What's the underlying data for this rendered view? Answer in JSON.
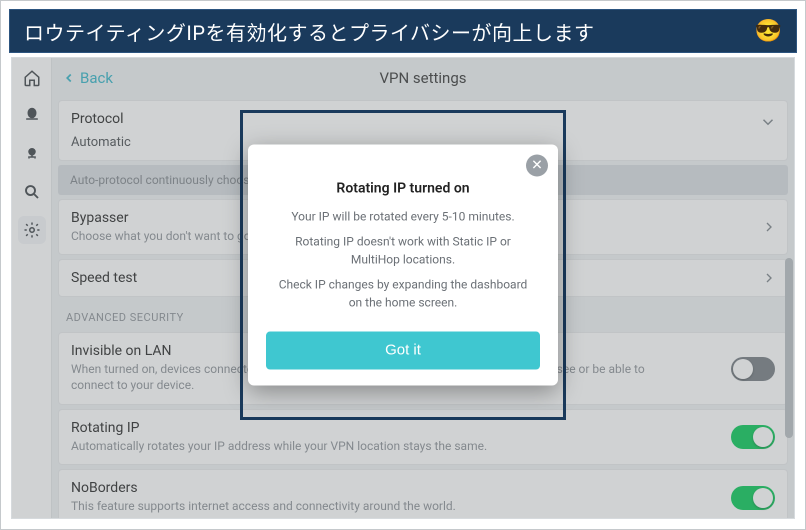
{
  "banner": {
    "text": "ロウテイティングIPを有効化するとプライバシーが向上します",
    "emoji": "😎"
  },
  "app": {
    "back_label": "Back",
    "page_title": "VPN settings",
    "protocol": {
      "label": "Protocol",
      "value": "Automatic",
      "note": "Auto-protocol continuously chooses the best protocol for you."
    },
    "bypasser": {
      "label": "Bypasser",
      "desc": "Choose what you don't want to go through VPN."
    },
    "speed_test": {
      "label": "Speed test"
    },
    "category_advanced": "ADVANCED SECURITY",
    "invisible_lan": {
      "label": "Invisible on LAN",
      "desc": "When turned on, devices connected to the same local area network, like printers, TVs, won't see or be able to connect to your device.",
      "enabled": false
    },
    "rotating_ip": {
      "label": "Rotating IP",
      "desc": "Automatically rotates your IP address while your VPN location stays the same.",
      "enabled": true
    },
    "noborders": {
      "label": "NoBorders",
      "desc": "This feature supports internet access and connectivity around the world.",
      "enabled": true
    }
  },
  "modal": {
    "title": "Rotating IP turned on",
    "line1": "Your IP will be rotated every 5-10 minutes.",
    "line2": "Rotating IP doesn't work with Static IP or MultiHop locations.",
    "line3": "Check IP changes by expanding the dashboard on the home screen.",
    "cta": "Got it"
  },
  "colors": {
    "banner_bg": "#1a3a5c",
    "accent_teal": "#3fc7d0",
    "toggle_on": "#00c853"
  }
}
